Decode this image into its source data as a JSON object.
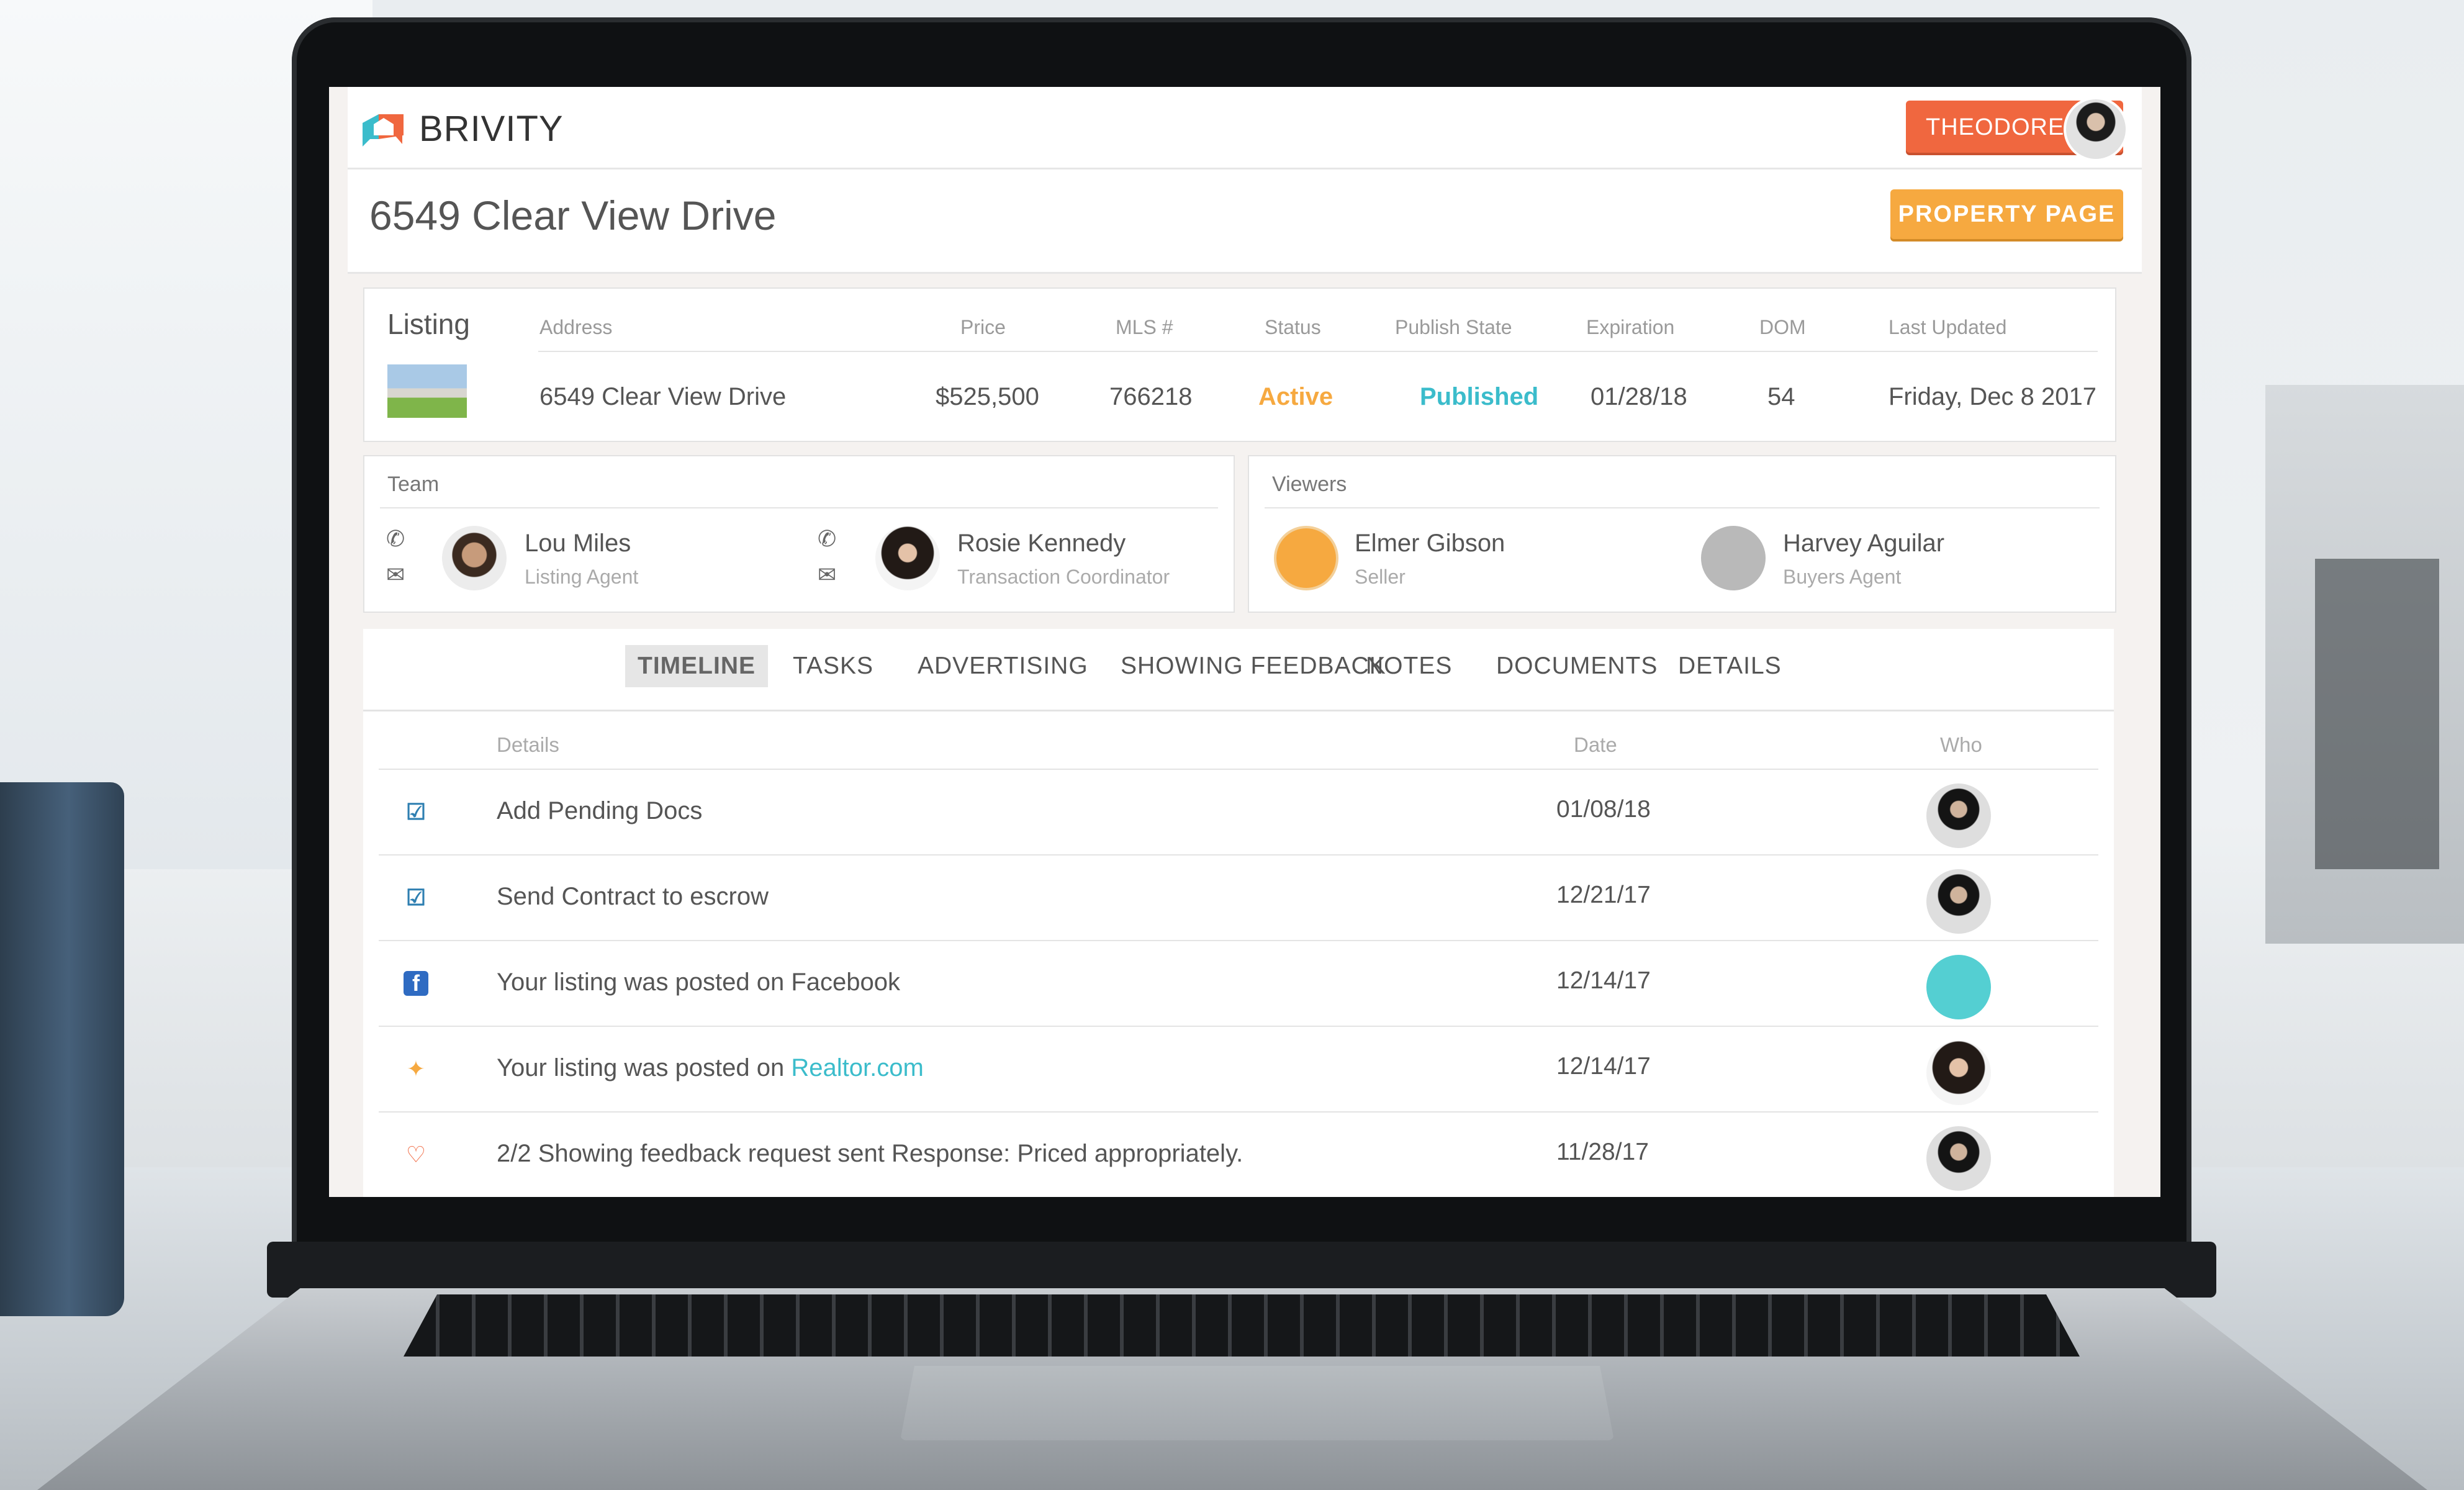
{
  "app": {
    "brand": "BRIVITY",
    "user_label": "THEODORE"
  },
  "property": {
    "title": "6549 Clear View Drive",
    "property_page_label": "PROPERTY PAGE"
  },
  "listing": {
    "section_label": "Listing",
    "headers": [
      "Address",
      "Price",
      "MLS #",
      "Status",
      "Publish State",
      "Expiration",
      "DOM",
      "Last Updated"
    ],
    "values": {
      "address": "6549 Clear View Drive",
      "price": "$525,500",
      "mls": "766218",
      "status": "Active",
      "publish_state": "Published",
      "expiration": "01/28/18",
      "dom": "54",
      "last_updated": "Friday, Dec 8 2017"
    },
    "colors": {
      "status": "#f6a940",
      "publish_state": "#3bbccb"
    }
  },
  "team": {
    "label": "Team",
    "members": [
      {
        "name": "Lou Miles",
        "role": "Listing Agent"
      },
      {
        "name": "Rosie Kennedy",
        "role": "Transaction Coordinator"
      }
    ]
  },
  "viewers": {
    "label": "Viewers",
    "members": [
      {
        "name": "Elmer Gibson",
        "role": "Seller"
      },
      {
        "name": "Harvey Aguilar",
        "role": "Buyers Agent"
      }
    ]
  },
  "tabs": [
    "TIMELINE",
    "TASKS",
    "ADVERTISING",
    "SHOWING FEEDBACK",
    "NOTES",
    "DOCUMENTS",
    "DETAILS"
  ],
  "active_tab": "TIMELINE",
  "timeline": {
    "headers": {
      "details": "Details",
      "date": "Date",
      "who": "Who"
    },
    "rows": [
      {
        "icon": "checkbox-icon",
        "text": "Add Pending Docs",
        "date": "01/08/18"
      },
      {
        "icon": "checkbox-icon",
        "text": "Send Contract to escrow",
        "date": "12/21/17"
      },
      {
        "icon": "facebook-icon",
        "text": "Your listing was posted on Facebook",
        "date": "12/14/17"
      },
      {
        "icon": "realtor-icon",
        "text_prefix": "Your listing was posted on ",
        "link": "Realtor.com",
        "date": "12/14/17"
      },
      {
        "icon": "heart-icon",
        "text": "2/2 Showing feedback request sent Response: Priced appropriately.",
        "date": "11/28/17"
      }
    ]
  },
  "colors": {
    "brand_orange": "#f0673f",
    "accent_yellow": "#f6a940",
    "accent_teal": "#3bbccb"
  }
}
